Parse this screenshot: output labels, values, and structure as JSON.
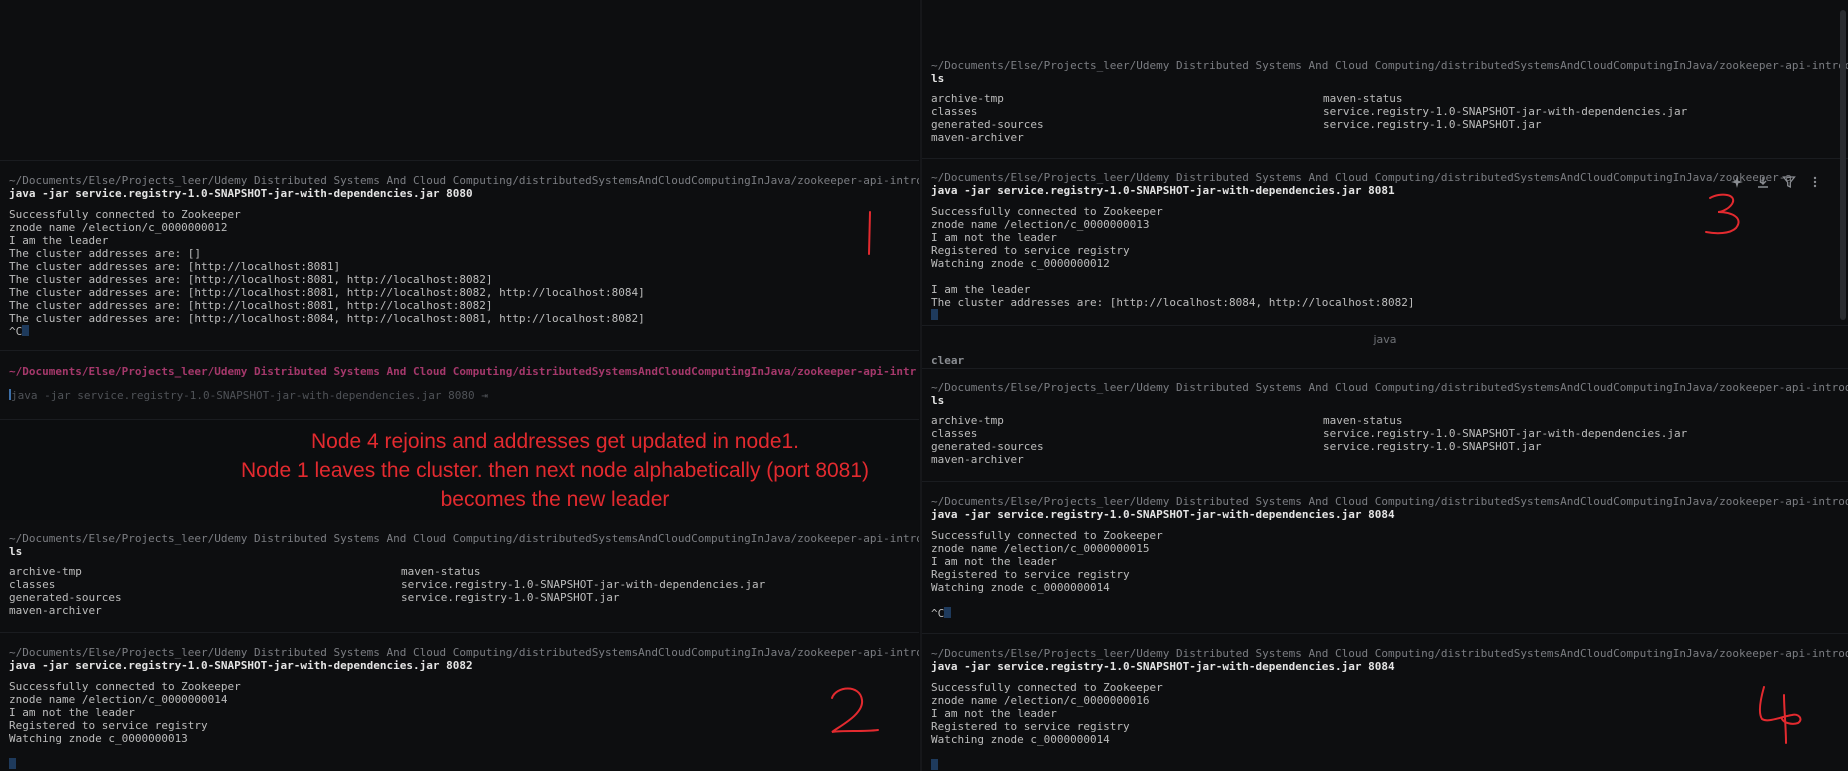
{
  "common": {
    "path": "~/Documents/Else/Projects_leer/Udemy Distributed Systems And Cloud Computing/distributedSystemsAndCloudComputingInJava/zookeeper-api-introduction/target",
    "path_truncated": "~/Documents/Else/Projects_leer/Udemy Distributed Systems And Cloud Computing/distributedSystemsAndCloudComputingInJava/zookeeper-api-introduction/target",
    "path_node3_short": "~/Documents/Else/Projects_leer/Udemy Distributed Systems And Cloud Computing/distributedSystemsAndCloudComputingInJava/zookeeper-a",
    "path_highlight": "~/Documents/Else/Projects_leer/Udemy Distributed Systems And Cloud Computing/distributedSystemsAndCloudComputingInJava/zookeeper-api-intr",
    "ls_cmd": "ls",
    "ls_col1": [
      "archive-tmp",
      "classes",
      "generated-sources",
      "maven-archiver"
    ],
    "ls_col2": [
      "maven-status",
      "service.registry-1.0-SNAPSHOT-jar-with-dependencies.jar",
      "service.registry-1.0-SNAPSHOT.jar"
    ]
  },
  "pane_left_top": {
    "command": "java -jar service.registry-1.0-SNAPSHOT-jar-with-dependencies.jar 8080",
    "output": [
      "Successfully connected to Zookeeper",
      "znode name /election/c_0000000012",
      "I am the leader",
      "The cluster addresses are: []",
      "The cluster addresses are: [http://localhost:8081]",
      "The cluster addresses are: [http://localhost:8081, http://localhost:8082]",
      "The cluster addresses are: [http://localhost:8081, http://localhost:8082, http://localhost:8084]",
      "The cluster addresses are: [http://localhost:8081, http://localhost:8082]",
      "The cluster addresses are: [http://localhost:8084, http://localhost:8081, http://localhost:8082]"
    ],
    "interrupt": "^C",
    "suggestion": "java -jar service.registry-1.0-SNAPSHOT-jar-with-dependencies.jar 8080 ⇥",
    "label": "1"
  },
  "pane_left_bottom": {
    "command": "java -jar service.registry-1.0-SNAPSHOT-jar-with-dependencies.jar 8082",
    "output": [
      "Successfully connected to Zookeeper",
      "znode name /election/c_0000000014",
      "I am not the leader",
      "Registered to service registry",
      "Watching znode c_0000000013"
    ],
    "label": "2"
  },
  "pane_right_top": {
    "command": "java -jar service.registry-1.0-SNAPSHOT-jar-with-dependencies.jar 8081",
    "output": [
      "Successfully connected to Zookeeper",
      "znode name /election/c_0000000013",
      "I am not the leader",
      "Registered to service registry",
      "Watching znode c_0000000012",
      "",
      "I am the leader",
      "The cluster addresses are: [http://localhost:8084, http://localhost:8082]"
    ],
    "label": "3",
    "title": "java",
    "next_cmd": "clear"
  },
  "pane_right_bottom": {
    "command_a": "java -jar service.registry-1.0-SNAPSHOT-jar-with-dependencies.jar 8084",
    "output_a": [
      "Successfully connected to Zookeeper",
      "znode name /election/c_0000000015",
      "I am not the leader",
      "Registered to service registry",
      "Watching znode c_0000000014",
      "",
      "^C"
    ],
    "command_b": "java -jar service.registry-1.0-SNAPSHOT-jar-with-dependencies.jar 8084",
    "output_b": [
      "Successfully connected to Zookeeper",
      "znode name /election/c_0000000016",
      "I am not the leader",
      "Registered to service registry",
      "Watching znode c_0000000014"
    ],
    "label": "4"
  },
  "annotation": {
    "line1": "Node 4 rejoins and addresses get updated in node1.",
    "line2": "Node 1 leaves the cluster. then next node alphabetically (port 8081)",
    "line3": "becomes the new leader"
  },
  "colors": {
    "annotation": "#e32a2f",
    "path_highlight": "#a5386b",
    "cursor": "#1e3a5c"
  },
  "icons": [
    "sparkle-icon",
    "download-icon",
    "filter-icon",
    "more-icon"
  ]
}
